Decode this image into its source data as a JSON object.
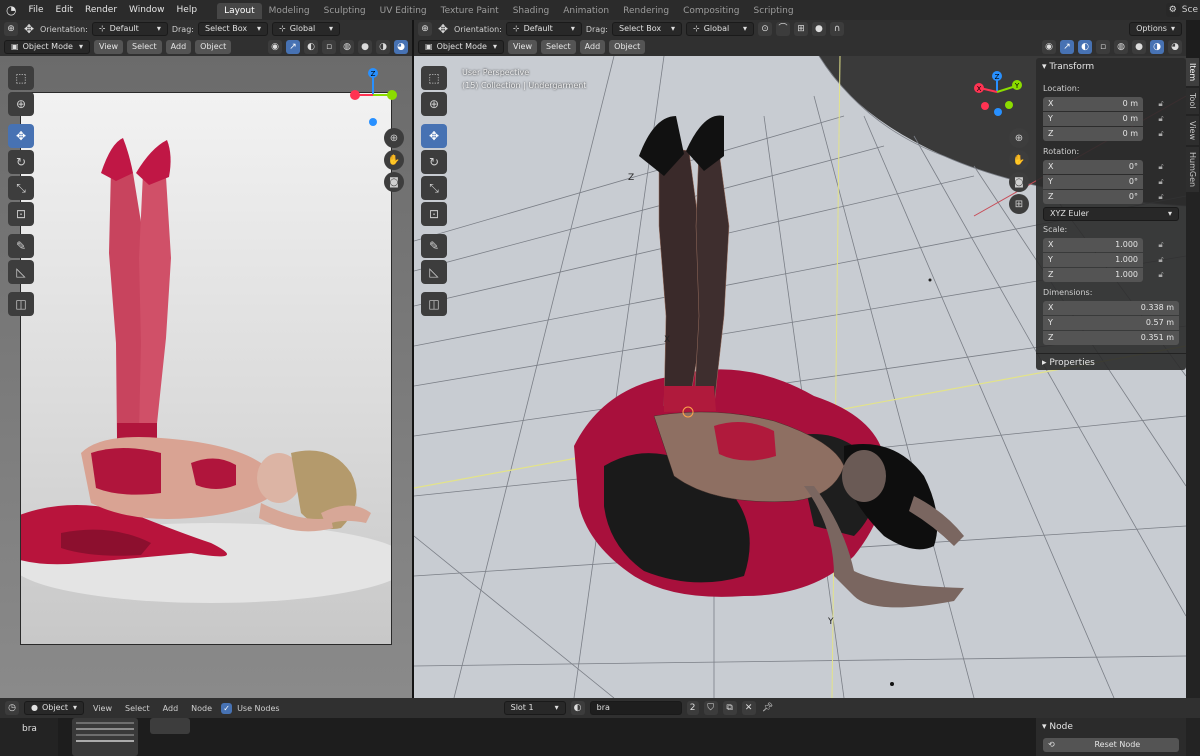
{
  "topbar": {
    "menu": [
      "File",
      "Edit",
      "Render",
      "Window",
      "Help"
    ],
    "workspaces": [
      {
        "label": "Layout",
        "active": true
      },
      {
        "label": "Modeling",
        "active": false
      },
      {
        "label": "Sculpting",
        "active": false
      },
      {
        "label": "UV Editing",
        "active": false
      },
      {
        "label": "Texture Paint",
        "active": false
      },
      {
        "label": "Shading",
        "active": false
      },
      {
        "label": "Animation",
        "active": false
      },
      {
        "label": "Rendering",
        "active": false
      },
      {
        "label": "Compositing",
        "active": false
      },
      {
        "label": "Scripting",
        "active": false
      }
    ],
    "scene_label": "Sce"
  },
  "left_view": {
    "orientation_label": "Orientation:",
    "orientation_value": "Default",
    "drag_label": "Drag:",
    "drag_value": "Select Box",
    "transform_value": "Global",
    "mode": "Object Mode",
    "menus": [
      "View",
      "Select",
      "Add",
      "Object"
    ]
  },
  "right_view": {
    "orientation_label": "Orientation:",
    "orientation_value": "Default",
    "drag_label": "Drag:",
    "drag_value": "Select Box",
    "transform_value": "Global",
    "options_label": "Options",
    "mode": "Object Mode",
    "menus": [
      "View",
      "Select",
      "Add",
      "Object"
    ],
    "overlay_line1": "User Perspective",
    "overlay_line2": "(15) Collection | Undergarment"
  },
  "npanel": {
    "transform_title": "Transform",
    "location_label": "Location:",
    "location": [
      {
        "axis": "X",
        "value": "0 m"
      },
      {
        "axis": "Y",
        "value": "0 m"
      },
      {
        "axis": "Z",
        "value": "0 m"
      }
    ],
    "rotation_label": "Rotation:",
    "rotation": [
      {
        "axis": "X",
        "value": "0°"
      },
      {
        "axis": "Y",
        "value": "0°"
      },
      {
        "axis": "Z",
        "value": "0°"
      }
    ],
    "rotation_mode": "XYZ Euler",
    "scale_label": "Scale:",
    "scale": [
      {
        "axis": "X",
        "value": "1.000"
      },
      {
        "axis": "Y",
        "value": "1.000"
      },
      {
        "axis": "Z",
        "value": "1.000"
      }
    ],
    "dimensions_label": "Dimensions:",
    "dimensions": [
      {
        "axis": "X",
        "value": "0.338 m"
      },
      {
        "axis": "Y",
        "value": "0.57 m"
      },
      {
        "axis": "Z",
        "value": "0.351 m"
      }
    ],
    "properties_title": "Properties",
    "tabs": [
      {
        "label": "Item",
        "active": true
      },
      {
        "label": "Tool",
        "active": false
      },
      {
        "label": "View",
        "active": false
      },
      {
        "label": "HumGen",
        "active": false
      }
    ]
  },
  "bottom": {
    "object_label": "Object",
    "menus": [
      "View",
      "Select",
      "Add",
      "Node"
    ],
    "use_nodes_label": "Use Nodes",
    "use_nodes_checked": true,
    "slot_label": "Slot 1",
    "material_name": "bra",
    "user_count": "2",
    "node_panel_title": "Node",
    "reset_node_label": "Reset Node",
    "material_list_item": "bra"
  },
  "colors": {
    "accent": "#4772b3",
    "header": "#303030",
    "background": "#1d1d1d",
    "x_axis": "#ff3352",
    "y_axis": "#8bdc00",
    "z_axis": "#2890ff"
  }
}
